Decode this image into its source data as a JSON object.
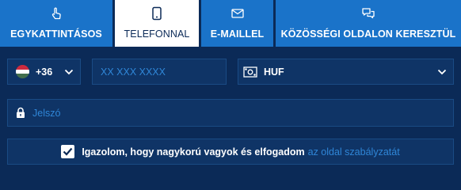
{
  "tabs": [
    {
      "label": "EGYKATTINTÁSOS",
      "icon": "hand-pointer-icon",
      "active": false
    },
    {
      "label": "TELEFONNAL",
      "icon": "phone-icon",
      "active": true
    },
    {
      "label": "E-MAILLEL",
      "icon": "envelope-icon",
      "active": false
    },
    {
      "label": "KÖZÖSSÉGI OLDALON KERESZTÜL",
      "icon": "chat-bubbles-icon",
      "active": false
    }
  ],
  "form": {
    "phone_code": {
      "value": "+36",
      "flag": "hungary-flag-icon"
    },
    "phone_number": {
      "placeholder": "XX XXX XXXX"
    },
    "currency": {
      "value": "HUF",
      "icon": "banknote-icon"
    },
    "password": {
      "placeholder": "Jelszó",
      "icon": "lock-icon"
    },
    "terms": {
      "checked": true,
      "text": "Igazolom, hogy nagykorú vagyok és elfogadom",
      "link": "az oldal szabályzatát"
    }
  },
  "colors": {
    "background": "#0b2a57",
    "tab": "#1a73c9",
    "field": "#0f3466",
    "accent": "#2f86d7"
  }
}
